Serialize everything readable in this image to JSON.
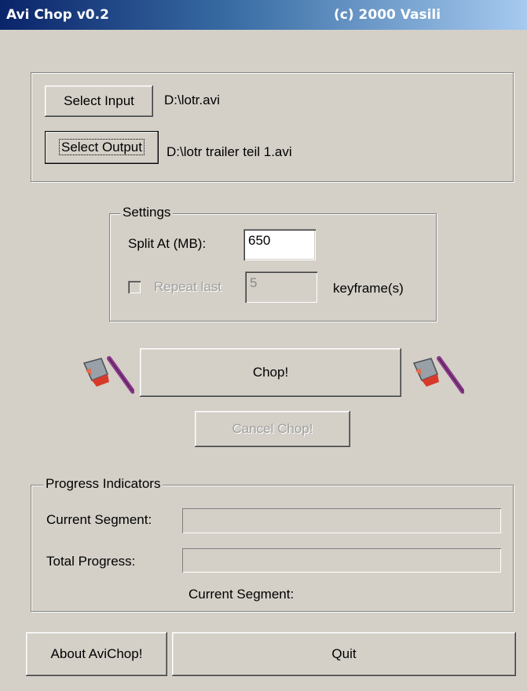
{
  "window": {
    "title": "Avi Chop v0.2",
    "copyright": "(c) 2000 Vasili"
  },
  "files": {
    "select_input_label": "Select Input",
    "input_path": "D:\\lotr.avi",
    "select_output_label": "Select Output",
    "output_path": "D:\\lotr trailer teil 1.avi"
  },
  "settings": {
    "legend": "Settings",
    "split_label": "Split At (MB):",
    "split_value": "650",
    "repeat_label": "Repeat last",
    "repeat_value": "5",
    "repeat_checked": false,
    "keyframe_label": "keyframe(s)"
  },
  "actions": {
    "chop_label": "Chop!",
    "cancel_label": "Cancel Chop!",
    "left_icon": "axe-icon",
    "right_icon": "axe-icon"
  },
  "progress": {
    "legend": "Progress Indicators",
    "current_segment_label": "Current Segment:",
    "current_segment_fraction": 0,
    "total_progress_label": "Total Progress:",
    "total_progress_fraction": 0,
    "status_text": "Current Segment:"
  },
  "footer": {
    "about_label": "About AviChop!",
    "quit_label": "Quit"
  },
  "colors": {
    "face": "#d4d0c8",
    "title_start": "#0a246a",
    "title_end": "#a6caf0",
    "axe_handle": "#8a3a8a",
    "axe_blade": "#9aa0a8",
    "axe_accent": "#d83a2a"
  }
}
